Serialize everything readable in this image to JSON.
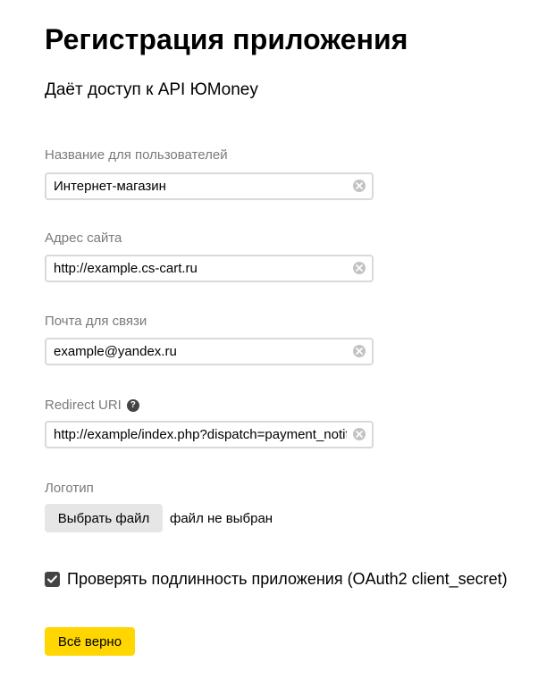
{
  "header": {
    "title": "Регистрация приложения",
    "subtitle": "Даёт доступ к API ЮMoney"
  },
  "form": {
    "name": {
      "label": "Название для пользователей",
      "value": "Интернет-магазин"
    },
    "site": {
      "label": "Адрес сайта",
      "value": "http://example.cs-cart.ru"
    },
    "email": {
      "label": "Почта для связи",
      "value": "example@yandex.ru"
    },
    "redirect": {
      "label": "Redirect URI",
      "help_icon": "?",
      "value": "http://example/index.php?dispatch=payment_notifi"
    },
    "logo": {
      "label": "Логотип",
      "button_label": "Выбрать файл",
      "status": "файл не выбран"
    },
    "verify": {
      "checked": true,
      "label": "Проверять подлинность приложения (OAuth2 client_secret)"
    },
    "submit_label": "Всё верно"
  },
  "colors": {
    "accent": "#ffd600",
    "label": "#7a7a7a",
    "border": "#d9d9d9"
  },
  "icons": {
    "clear": "clear-icon",
    "help": "help-icon",
    "check": "check-icon"
  }
}
